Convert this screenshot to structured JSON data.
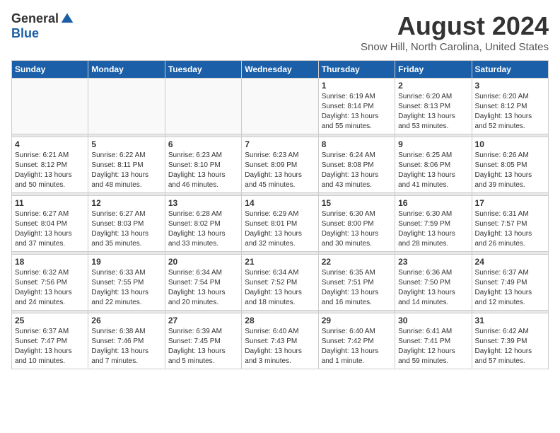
{
  "logo": {
    "general": "General",
    "blue": "Blue"
  },
  "header": {
    "month": "August 2024",
    "location": "Snow Hill, North Carolina, United States"
  },
  "weekdays": [
    "Sunday",
    "Monday",
    "Tuesday",
    "Wednesday",
    "Thursday",
    "Friday",
    "Saturday"
  ],
  "weeks": [
    [
      {
        "day": "",
        "info": ""
      },
      {
        "day": "",
        "info": ""
      },
      {
        "day": "",
        "info": ""
      },
      {
        "day": "",
        "info": ""
      },
      {
        "day": "1",
        "info": "Sunrise: 6:19 AM\nSunset: 8:14 PM\nDaylight: 13 hours\nand 55 minutes."
      },
      {
        "day": "2",
        "info": "Sunrise: 6:20 AM\nSunset: 8:13 PM\nDaylight: 13 hours\nand 53 minutes."
      },
      {
        "day": "3",
        "info": "Sunrise: 6:20 AM\nSunset: 8:12 PM\nDaylight: 13 hours\nand 52 minutes."
      }
    ],
    [
      {
        "day": "4",
        "info": "Sunrise: 6:21 AM\nSunset: 8:12 PM\nDaylight: 13 hours\nand 50 minutes."
      },
      {
        "day": "5",
        "info": "Sunrise: 6:22 AM\nSunset: 8:11 PM\nDaylight: 13 hours\nand 48 minutes."
      },
      {
        "day": "6",
        "info": "Sunrise: 6:23 AM\nSunset: 8:10 PM\nDaylight: 13 hours\nand 46 minutes."
      },
      {
        "day": "7",
        "info": "Sunrise: 6:23 AM\nSunset: 8:09 PM\nDaylight: 13 hours\nand 45 minutes."
      },
      {
        "day": "8",
        "info": "Sunrise: 6:24 AM\nSunset: 8:08 PM\nDaylight: 13 hours\nand 43 minutes."
      },
      {
        "day": "9",
        "info": "Sunrise: 6:25 AM\nSunset: 8:06 PM\nDaylight: 13 hours\nand 41 minutes."
      },
      {
        "day": "10",
        "info": "Sunrise: 6:26 AM\nSunset: 8:05 PM\nDaylight: 13 hours\nand 39 minutes."
      }
    ],
    [
      {
        "day": "11",
        "info": "Sunrise: 6:27 AM\nSunset: 8:04 PM\nDaylight: 13 hours\nand 37 minutes."
      },
      {
        "day": "12",
        "info": "Sunrise: 6:27 AM\nSunset: 8:03 PM\nDaylight: 13 hours\nand 35 minutes."
      },
      {
        "day": "13",
        "info": "Sunrise: 6:28 AM\nSunset: 8:02 PM\nDaylight: 13 hours\nand 33 minutes."
      },
      {
        "day": "14",
        "info": "Sunrise: 6:29 AM\nSunset: 8:01 PM\nDaylight: 13 hours\nand 32 minutes."
      },
      {
        "day": "15",
        "info": "Sunrise: 6:30 AM\nSunset: 8:00 PM\nDaylight: 13 hours\nand 30 minutes."
      },
      {
        "day": "16",
        "info": "Sunrise: 6:30 AM\nSunset: 7:59 PM\nDaylight: 13 hours\nand 28 minutes."
      },
      {
        "day": "17",
        "info": "Sunrise: 6:31 AM\nSunset: 7:57 PM\nDaylight: 13 hours\nand 26 minutes."
      }
    ],
    [
      {
        "day": "18",
        "info": "Sunrise: 6:32 AM\nSunset: 7:56 PM\nDaylight: 13 hours\nand 24 minutes."
      },
      {
        "day": "19",
        "info": "Sunrise: 6:33 AM\nSunset: 7:55 PM\nDaylight: 13 hours\nand 22 minutes."
      },
      {
        "day": "20",
        "info": "Sunrise: 6:34 AM\nSunset: 7:54 PM\nDaylight: 13 hours\nand 20 minutes."
      },
      {
        "day": "21",
        "info": "Sunrise: 6:34 AM\nSunset: 7:52 PM\nDaylight: 13 hours\nand 18 minutes."
      },
      {
        "day": "22",
        "info": "Sunrise: 6:35 AM\nSunset: 7:51 PM\nDaylight: 13 hours\nand 16 minutes."
      },
      {
        "day": "23",
        "info": "Sunrise: 6:36 AM\nSunset: 7:50 PM\nDaylight: 13 hours\nand 14 minutes."
      },
      {
        "day": "24",
        "info": "Sunrise: 6:37 AM\nSunset: 7:49 PM\nDaylight: 13 hours\nand 12 minutes."
      }
    ],
    [
      {
        "day": "25",
        "info": "Sunrise: 6:37 AM\nSunset: 7:47 PM\nDaylight: 13 hours\nand 10 minutes."
      },
      {
        "day": "26",
        "info": "Sunrise: 6:38 AM\nSunset: 7:46 PM\nDaylight: 13 hours\nand 7 minutes."
      },
      {
        "day": "27",
        "info": "Sunrise: 6:39 AM\nSunset: 7:45 PM\nDaylight: 13 hours\nand 5 minutes."
      },
      {
        "day": "28",
        "info": "Sunrise: 6:40 AM\nSunset: 7:43 PM\nDaylight: 13 hours\nand 3 minutes."
      },
      {
        "day": "29",
        "info": "Sunrise: 6:40 AM\nSunset: 7:42 PM\nDaylight: 13 hours\nand 1 minute."
      },
      {
        "day": "30",
        "info": "Sunrise: 6:41 AM\nSunset: 7:41 PM\nDaylight: 12 hours\nand 59 minutes."
      },
      {
        "day": "31",
        "info": "Sunrise: 6:42 AM\nSunset: 7:39 PM\nDaylight: 12 hours\nand 57 minutes."
      }
    ]
  ]
}
